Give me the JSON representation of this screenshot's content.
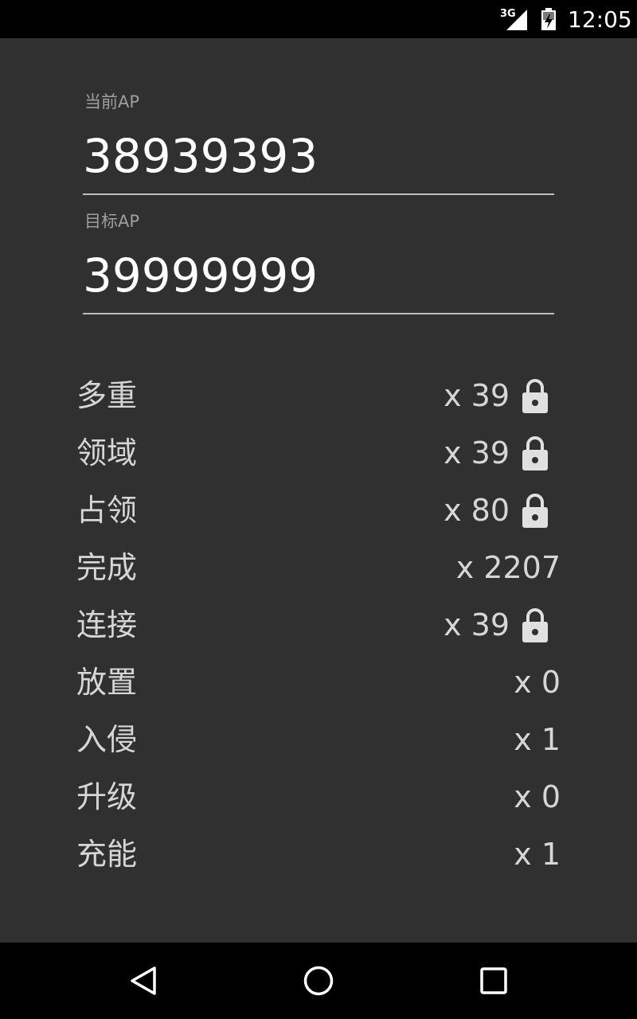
{
  "status_bar": {
    "network": "3G",
    "time": "12:05",
    "icons": [
      "signal-icon",
      "battery-charging-icon"
    ]
  },
  "fields": {
    "current_ap": {
      "label": "当前AP",
      "value": "38939393"
    },
    "target_ap": {
      "label": "目标AP",
      "value": "39999999"
    }
  },
  "stats": [
    {
      "label": "多重",
      "value": "x 39",
      "locked": true
    },
    {
      "label": "领域",
      "value": "x 39",
      "locked": true
    },
    {
      "label": "占领",
      "value": "x 80",
      "locked": true
    },
    {
      "label": "完成",
      "value": "x 2207",
      "locked": false
    },
    {
      "label": "连接",
      "value": "x 39",
      "locked": true
    },
    {
      "label": "放置",
      "value": "x 0",
      "locked": false
    },
    {
      "label": "入侵",
      "value": "x 1",
      "locked": false
    },
    {
      "label": "升级",
      "value": "x 0",
      "locked": false
    },
    {
      "label": "充能",
      "value": "x 1",
      "locked": false
    }
  ],
  "nav_bar": {
    "icons": [
      "back-icon",
      "home-icon",
      "recents-icon"
    ]
  },
  "colors": {
    "background": "#303030",
    "bars": "#000000",
    "text_primary": "#ffffff",
    "text_secondary": "#d6d6d6",
    "label": "#9e9e9e",
    "icon": "#e0e0e0"
  }
}
